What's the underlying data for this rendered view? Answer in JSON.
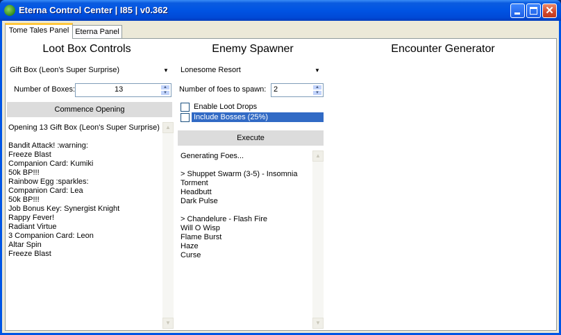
{
  "window": {
    "title": "Eterna Control Center | I85 | v0.362",
    "minimize_glyph": "",
    "maximize_glyph": "",
    "close_glyph": "✕"
  },
  "tabs": [
    {
      "label": "Tome Tales Panel",
      "active": true
    },
    {
      "label": "Eterna Panel",
      "active": false
    }
  ],
  "loot_box": {
    "heading": "Loot Box Controls",
    "box_type": "Gift Box (Leon's Super Surprise)",
    "count_label": "Number of Boxes:",
    "count_value": "13",
    "open_button": "Commence Opening",
    "log": [
      "Opening 13 Gift Box (Leon's Super Surprise)",
      "",
      "Bandit Attack! :warning:",
      "Freeze Blast",
      "Companion Card: Kumiki",
      "50k BP!!!",
      "Rainbow Egg :sparkles:",
      "Companion Card: Lea",
      "50k BP!!!",
      "Job Bonus Key: Synergist Knight",
      "Rappy Fever!",
      "Radiant Virtue",
      "3 Companion Card: Leon",
      "Altar Spin",
      "Freeze Blast"
    ]
  },
  "enemy_spawner": {
    "heading": "Enemy Spawner",
    "location": "Lonesome Resort",
    "foes_label": "Number of foes to spawn:",
    "foes_value": "2",
    "loot_drops_label": "Enable Loot Drops",
    "bosses_label": "Include Bosses (25%)",
    "execute_button": "Execute",
    "log": [
      "Generating Foes...",
      "",
      "> Shuppet Swarm (3-5) - Insomnia",
      "Torment",
      "Headbutt",
      "Dark Pulse",
      "",
      "> Chandelure - Flash Fire",
      "Will O Wisp",
      "Flame Burst",
      "Haze",
      "Curse"
    ]
  },
  "encounter_generator": {
    "heading": "Encounter Generator"
  },
  "colors": {
    "title_bar": "#0054e3",
    "tab_highlight": "#ffc73c",
    "selection": "#316ac5",
    "button_bg": "#dcdcdc"
  }
}
